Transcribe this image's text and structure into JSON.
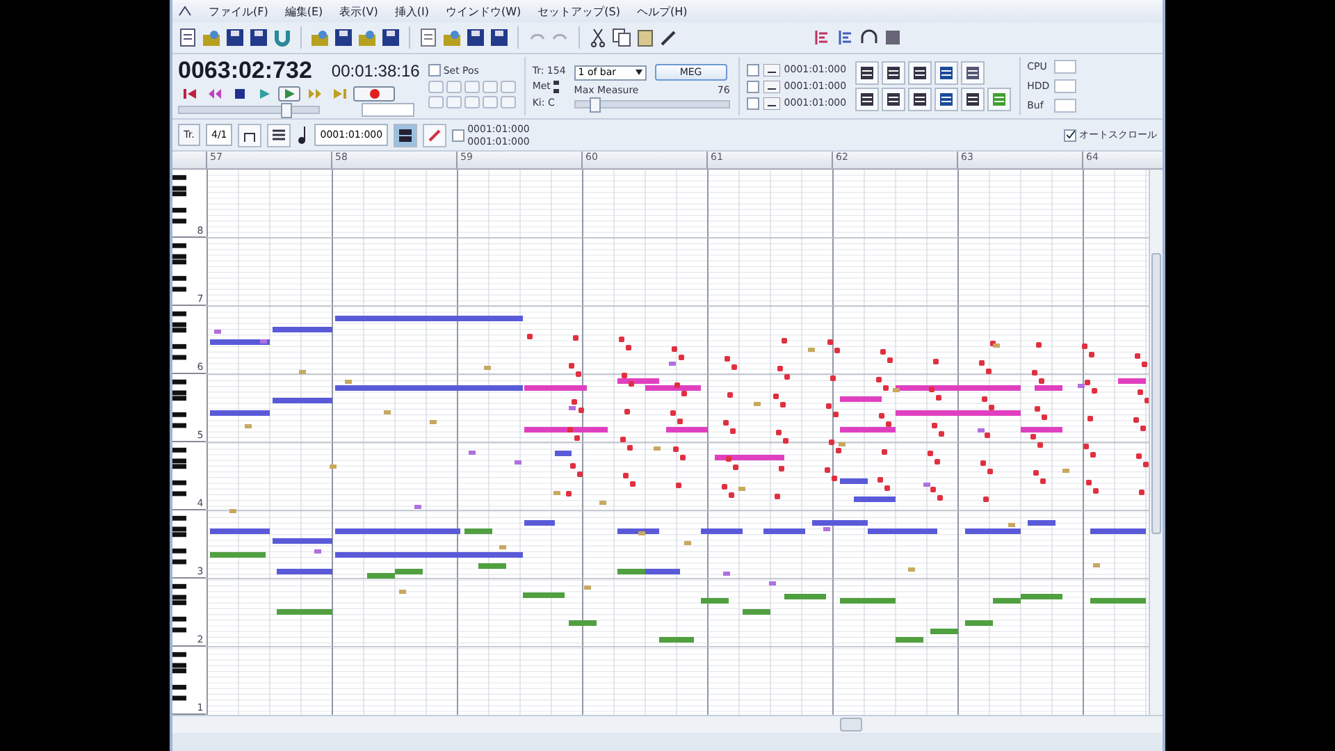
{
  "menu": [
    "ファイル(F)",
    "編集(E)",
    "表示(V)",
    "挿入(I)",
    "ウインドウ(W)",
    "セットアップ(S)",
    "ヘルプ(H)"
  ],
  "transport": {
    "position": "0063:02:732",
    "time": "00:01:38:16",
    "set_pos": {
      "label": "Set Pos",
      "checked": false
    },
    "position_slider": {
      "level": 0.78
    },
    "measure_slider": {
      "level": 0.1
    },
    "track": "Tr: 154",
    "meter": "Met",
    "key": "Ki: C",
    "snap": "1 of bar",
    "meg_button": "MEG",
    "max_measure": {
      "label": "Max Measure",
      "value": "76"
    },
    "locators": [
      {
        "time": "0001:01:000",
        "checked": false
      },
      {
        "time": "0001:01:000",
        "checked": false
      },
      {
        "time": "0001:01:000",
        "checked": false
      }
    ],
    "monitors": [
      "CPU",
      "HDD",
      "Buf"
    ]
  },
  "edit_bar": {
    "track_button": "Tr.",
    "quantize": "4/1",
    "range_start": "0001:01:000",
    "loop": {
      "checked": false,
      "values": [
        "0001:01:000",
        "0001:01:000"
      ]
    },
    "auto_scroll": {
      "label": "オートスクロール",
      "checked": true
    }
  },
  "ruler": {
    "measures": [
      "57",
      "58",
      "59",
      "60",
      "61",
      "62",
      "63",
      "64"
    ]
  },
  "keyboard": {
    "octaves": [
      "8",
      "7",
      "6",
      "5",
      "4",
      "3",
      "2",
      "1"
    ]
  }
}
